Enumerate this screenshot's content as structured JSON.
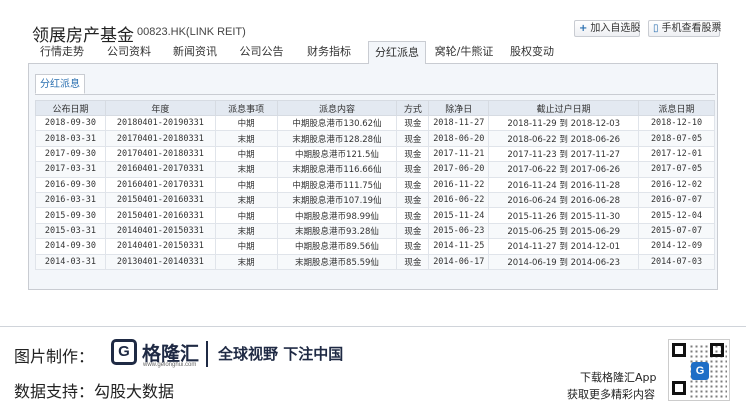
{
  "header": {
    "title": "领展房产基金",
    "code": "00823.HK(LINK REIT)",
    "add_favorite_label": "加入自选股",
    "add_favorite_icon": "plus-icon",
    "mobile_view_label": "手机查看股票",
    "mobile_view_icon": "phone-icon"
  },
  "tabs": [
    {
      "label": "行情走势",
      "active": false
    },
    {
      "label": "公司资料",
      "active": false
    },
    {
      "label": "新闻资讯",
      "active": false
    },
    {
      "label": "公司公告",
      "active": false
    },
    {
      "label": "财务指标",
      "active": false
    },
    {
      "label": "分红派息",
      "active": true
    },
    {
      "label": "窝轮/牛熊证",
      "active": false
    },
    {
      "label": "股权变动",
      "active": false
    }
  ],
  "subtab": {
    "label": "分红派息"
  },
  "table": {
    "columns": [
      "公布日期",
      "年度",
      "派息事项",
      "派息内容",
      "方式",
      "除净日",
      "截止过户日期",
      "派息日期"
    ],
    "rows": [
      [
        "2018-09-30",
        "20180401-20190331",
        "中期",
        "中期股息港币130.62仙",
        "现金",
        "2018-11-27",
        "2018-11-29 到 2018-12-03",
        "2018-12-10"
      ],
      [
        "2018-03-31",
        "20170401-20180331",
        "末期",
        "末期股息港币128.28仙",
        "现金",
        "2018-06-20",
        "2018-06-22 到 2018-06-26",
        "2018-07-05"
      ],
      [
        "2017-09-30",
        "20170401-20180331",
        "中期",
        "中期股息港币121.5仙",
        "现金",
        "2017-11-21",
        "2017-11-23 到 2017-11-27",
        "2017-12-01"
      ],
      [
        "2017-03-31",
        "20160401-20170331",
        "末期",
        "末期股息港币116.66仙",
        "现金",
        "2017-06-20",
        "2017-06-22 到 2017-06-26",
        "2017-07-05"
      ],
      [
        "2016-09-30",
        "20160401-20170331",
        "中期",
        "中期股息港币111.75仙",
        "现金",
        "2016-11-22",
        "2016-11-24 到 2016-11-28",
        "2016-12-02"
      ],
      [
        "2016-03-31",
        "20150401-20160331",
        "末期",
        "末期股息港币107.19仙",
        "现金",
        "2016-06-22",
        "2016-06-24 到 2016-06-28",
        "2016-07-07"
      ],
      [
        "2015-09-30",
        "20150401-20160331",
        "中期",
        "中期股息港币98.99仙",
        "现金",
        "2015-11-24",
        "2015-11-26 到 2015-11-30",
        "2015-12-04"
      ],
      [
        "2015-03-31",
        "20140401-20150331",
        "末期",
        "末期股息港币93.28仙",
        "现金",
        "2015-06-23",
        "2015-06-25 到 2015-06-29",
        "2015-07-07"
      ],
      [
        "2014-09-30",
        "20140401-20150331",
        "中期",
        "中期股息港币89.56仙",
        "现金",
        "2014-11-25",
        "2014-11-27 到 2014-12-01",
        "2014-12-09"
      ],
      [
        "2014-03-31",
        "20130401-20140331",
        "末期",
        "末期股息港币85.59仙",
        "现金",
        "2014-06-17",
        "2014-06-19 到 2014-06-23",
        "2014-07-03"
      ]
    ]
  },
  "watermark": "格隆汇",
  "footer": {
    "made_by_label": "图片制作：",
    "logo_name": "格隆汇",
    "logo_sub": "www.gelonghui.com",
    "slogan": "全球视野 下注中国",
    "data_support_label": "数据支持：",
    "data_support_value": "勾股大数据",
    "download_line1": "下载格隆汇App",
    "download_line2": "获取更多精彩内容",
    "qr_icon": "qr-code-icon"
  },
  "colors": {
    "accent": "#2a6fb0",
    "brand": "#1f2a44",
    "header_row_bg": "#e3e9f1",
    "panel_bg": "#f3f6fa"
  }
}
